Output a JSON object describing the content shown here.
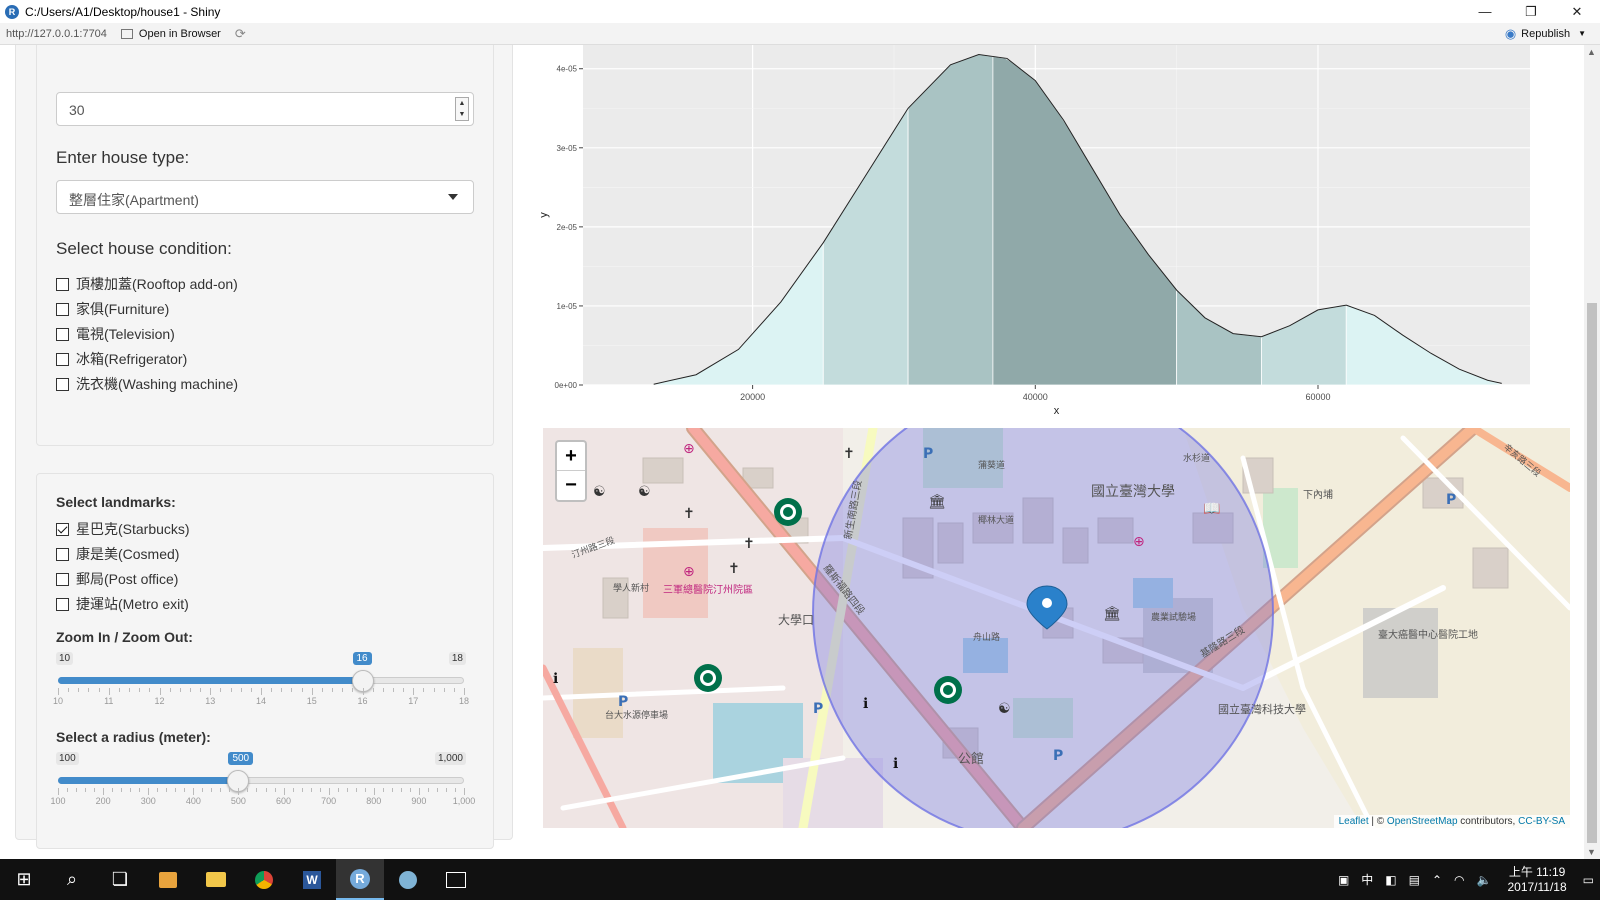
{
  "window": {
    "title": "C:/Users/A1/Desktop/house1 - Shiny",
    "controls": [
      "—",
      "❐",
      "✕"
    ]
  },
  "toolbar": {
    "url": "http://127.0.0.1:7704",
    "open_in_browser": "Open in Browser",
    "republish": "Republish"
  },
  "sidebar": {
    "number_input_value": "30",
    "house_type_label": "Enter house type:",
    "house_type_selected": "整層住家(Apartment)",
    "condition_label": "Select house condition:",
    "conditions": [
      {
        "label": "頂樓加蓋(Rooftop add-on)",
        "checked": false
      },
      {
        "label": "家俱(Furniture)",
        "checked": false
      },
      {
        "label": "電視(Television)",
        "checked": false
      },
      {
        "label": "冰箱(Refrigerator)",
        "checked": false
      },
      {
        "label": "洗衣機(Washing machine)",
        "checked": false
      }
    ],
    "landmarks_label": "Select landmarks:",
    "landmarks": [
      {
        "label": "星巴克(Starbucks)",
        "checked": true
      },
      {
        "label": "康是美(Cosmed)",
        "checked": false
      },
      {
        "label": "郵局(Post office)",
        "checked": false
      },
      {
        "label": "捷運站(Metro exit)",
        "checked": false
      }
    ],
    "zoom_slider": {
      "label": "Zoom In / Zoom Out:",
      "min": 10,
      "max": 18,
      "value": 16,
      "min_label": "10",
      "max_label": "18",
      "value_label": "16",
      "ticks": [
        "10",
        "11",
        "12",
        "13",
        "14",
        "15",
        "16",
        "17",
        "18"
      ]
    },
    "radius_slider": {
      "label": "Select a radius (meter):",
      "min": 100,
      "max": 1000,
      "value": 500,
      "min_label": "100",
      "max_label": "1,000",
      "value_label": "500",
      "ticks": [
        "100",
        "200",
        "300",
        "400",
        "500",
        "600",
        "700",
        "800",
        "900",
        "1,000"
      ]
    }
  },
  "chart_data": {
    "type": "area",
    "xlabel": "x",
    "ylabel": "y",
    "xlim": [
      8000,
      75000
    ],
    "ylim": [
      0,
      4.3e-05
    ],
    "x_ticks": [
      20000,
      40000,
      60000
    ],
    "x_tick_labels": [
      "20000",
      "40000",
      "60000"
    ],
    "y_ticks": [
      0,
      1e-05,
      2e-05,
      3e-05,
      4e-05
    ],
    "y_tick_labels": [
      "0e+00",
      "1e-05",
      "2e-05",
      "3e-05",
      "4e-05"
    ],
    "grid": true,
    "curve": {
      "x": [
        13000,
        16000,
        19000,
        22000,
        25000,
        28000,
        31000,
        34000,
        36000,
        38000,
        40000,
        42000,
        44000,
        46000,
        48000,
        50000,
        52000,
        54000,
        56000,
        58000,
        60000,
        62000,
        64000,
        66000,
        68000,
        70000,
        72000,
        73000
      ],
      "y": [
        1e-07,
        1.3e-06,
        4.5e-06,
        1.05e-05,
        1.8e-05,
        2.65e-05,
        3.5e-05,
        4.05e-05,
        4.18e-05,
        4.13e-05,
        3.85e-05,
        3.35e-05,
        2.75e-05,
        2.15e-05,
        1.65e-05,
        1.2e-05,
        8.5e-06,
        6.5e-06,
        6.1e-06,
        7.5e-06,
        9.5e-06,
        1.01e-05,
        8.8e-06,
        6.3e-06,
        4e-06,
        2e-06,
        6e-07,
        2e-07
      ]
    },
    "bands": [
      {
        "from": 13000,
        "to": 25000,
        "color": "#dcf3f3"
      },
      {
        "from": 25000,
        "to": 31000,
        "color": "#c3dcdc"
      },
      {
        "from": 31000,
        "to": 37000,
        "color": "#a9c3c3"
      },
      {
        "from": 37000,
        "to": 50000,
        "color": "#90a9a9"
      },
      {
        "from": 50000,
        "to": 56000,
        "color": "#a9c3c3"
      },
      {
        "from": 56000,
        "to": 62000,
        "color": "#c3dcdc"
      },
      {
        "from": 62000,
        "to": 73000,
        "color": "#dcf3f3"
      }
    ]
  },
  "map": {
    "zoom_in": "+",
    "zoom_out": "−",
    "attribution_leaflet": "Leaflet",
    "attribution_sep": " | © ",
    "attribution_osm": "OpenStreetMap",
    "attribution_mid": " contributors, ",
    "attribution_license": "CC-BY-SA",
    "labels": {
      "ntu": "國立臺灣大學",
      "ntust": "國立臺灣科技大學",
      "gongguan": "公館",
      "daxuekou": "大學口",
      "hospital": "三軍總醫院汀州院區",
      "cancer": "臺大癌醫中心醫院工地",
      "agri": "農業試驗場",
      "parking": "台大水源停車場",
      "road_keelung": "基隆路三段",
      "road_roosevelt": "羅斯福路四段",
      "road_xinsheng": "新生南路三段",
      "road_zhoushan": "舟山路",
      "road_tingzhou": "汀州路三段",
      "road_xinhai": "辛亥路三段",
      "xiaxianpu": "下內埔",
      "coconut": "椰林大道",
      "palm": "蒲葵道",
      "water": "水杉道",
      "xue": "學人新村"
    },
    "circle_color": "#6f73e4",
    "marker_color": "#2a81cb"
  },
  "taskbar": {
    "time": "上午 11:19",
    "date": "2017/11/18",
    "ime": "中"
  }
}
